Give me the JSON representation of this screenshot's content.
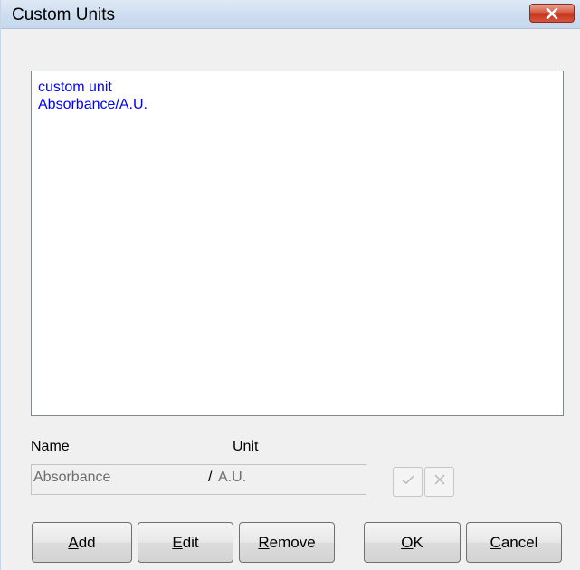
{
  "window": {
    "title": "Custom Units"
  },
  "units_list": {
    "items": [
      {
        "label": "custom unit"
      },
      {
        "label": "Absorbance/A.U."
      }
    ]
  },
  "fields": {
    "name_label": "Name",
    "unit_label": "Unit",
    "name_value": "Absorbance",
    "separator": "/",
    "unit_value": "A.U."
  },
  "buttons": {
    "add": {
      "mnemonic": "A",
      "rest": "dd"
    },
    "edit": {
      "mnemonic": "E",
      "rest": "dit"
    },
    "remove": {
      "mnemonic": "R",
      "rest": "emove"
    },
    "ok": {
      "mnemonic": "O",
      "rest": "K"
    },
    "cancel": {
      "mnemonic": "C",
      "rest": "ancel"
    }
  },
  "icons": {
    "close": "close-icon",
    "confirm": "check-icon",
    "discard": "x-icon"
  },
  "colors": {
    "list_text": "#0000ff",
    "close_button": "#d6553c",
    "disabled_text": "#6d6d6d"
  }
}
